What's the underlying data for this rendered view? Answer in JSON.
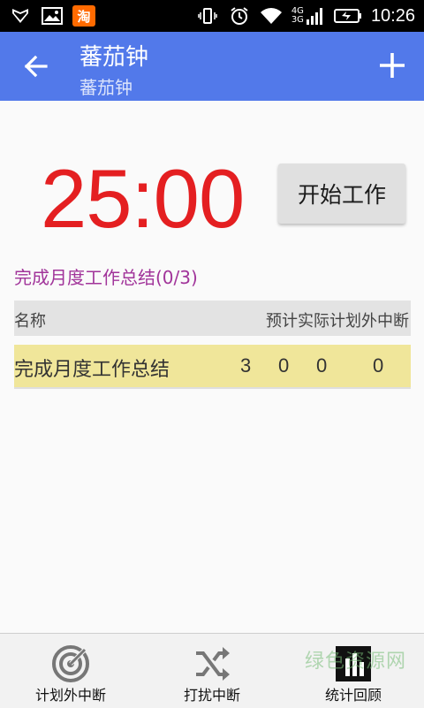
{
  "status_bar": {
    "time": "10:26",
    "network_4g": "4G",
    "network_3g": "3G",
    "taobao_glyph": "淘",
    "icons": [
      "shield-icon",
      "image-icon",
      "taobao-icon",
      "vibrate-icon",
      "alarm-icon",
      "wifi-icon",
      "signal-icon",
      "battery-icon"
    ]
  },
  "app_bar": {
    "title": "蕃茄钟",
    "subtitle": "蕃茄钟",
    "color": "#5279ea"
  },
  "timer": {
    "value": "25:00",
    "color": "#e41f21",
    "start_label": "开始工作"
  },
  "task": {
    "heading": "完成月度工作总结(0/3)"
  },
  "table": {
    "headers": [
      "名称",
      "预计",
      "实际",
      "计划外",
      "中断"
    ],
    "rows": [
      {
        "name": "完成月度工作总结",
        "estimated": "3",
        "actual": "0",
        "unplanned": "0",
        "interrupt": "0"
      }
    ]
  },
  "bottom_bar": {
    "items": [
      {
        "label": "计划外中断",
        "icon": "target-icon"
      },
      {
        "label": "打扰中断",
        "icon": "shuffle-icon"
      },
      {
        "label": "统计回顾",
        "icon": "stats-icon"
      }
    ]
  },
  "watermark": "绿色资源网"
}
